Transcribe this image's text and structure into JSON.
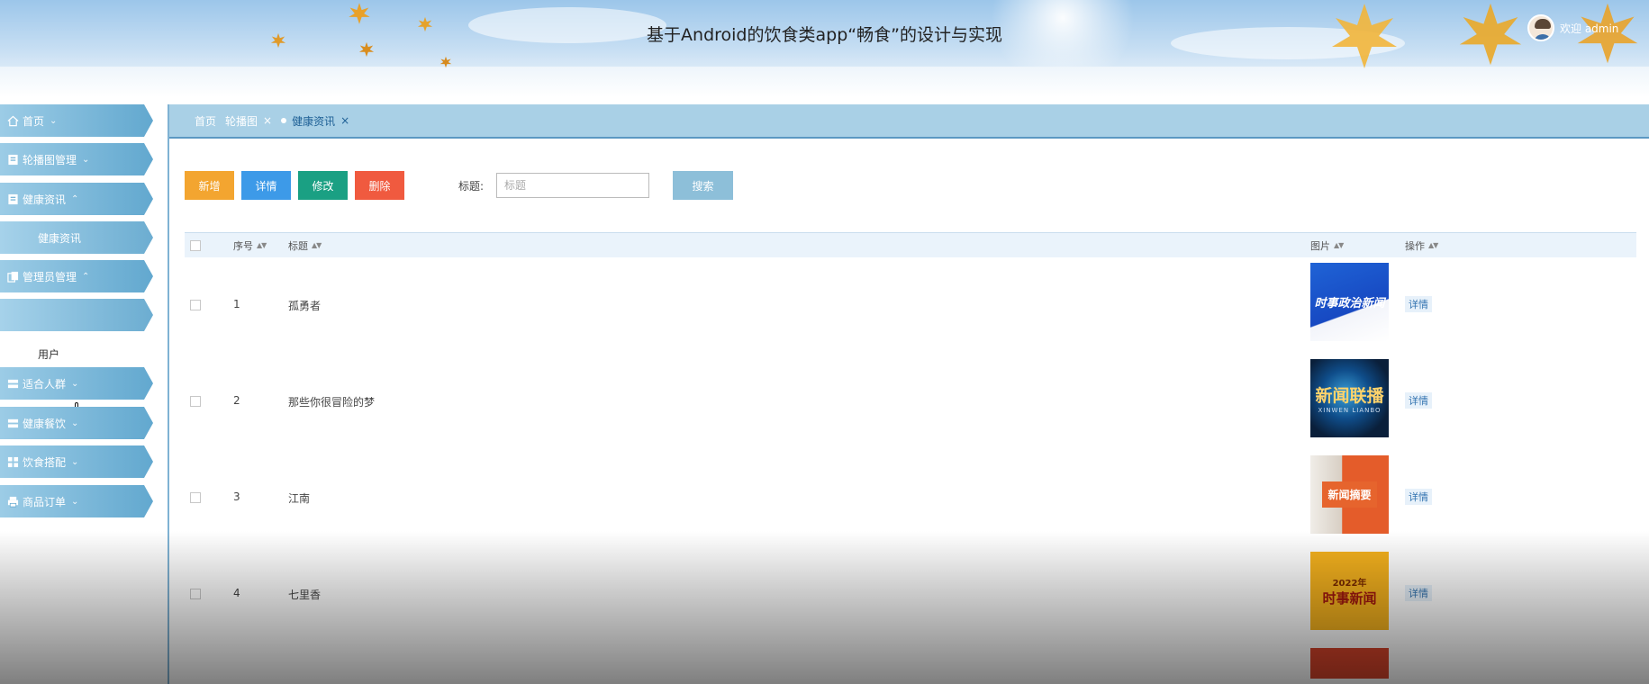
{
  "header": {
    "title": "基于Android的饮食类app“畅食”的设计与实现",
    "welcome": "欢迎 admin"
  },
  "sidebar": {
    "items": [
      {
        "label": "首页",
        "icon": "home-icon",
        "expanded": false
      },
      {
        "label": "轮播图管理",
        "icon": "doc-icon",
        "expanded": false
      },
      {
        "label": "健康资讯",
        "icon": "doc-icon",
        "expanded": true
      },
      {
        "label": "健康资讯",
        "sub": true
      },
      {
        "label": "管理员管理",
        "icon": "copy-icon",
        "expanded": true
      },
      {
        "label": "",
        "sub": true
      },
      {
        "label": "用户",
        "plain": true
      },
      {
        "label": "适合人群",
        "icon": "table-icon",
        "expanded": false
      },
      {
        "label": "健康餐饮",
        "icon": "table-icon",
        "expanded": false
      },
      {
        "label": "饮食搭配",
        "icon": "grid-icon",
        "expanded": false
      },
      {
        "label": "商品订单",
        "icon": "print-icon",
        "expanded": false
      }
    ]
  },
  "tabs": [
    {
      "label": "首页",
      "closable": false,
      "active": false
    },
    {
      "label": "轮播图",
      "closable": true,
      "active": false
    },
    {
      "label": "健康资讯",
      "closable": true,
      "active": true
    }
  ],
  "close_glyph": "×",
  "toolbar": {
    "add": "新增",
    "detail": "详情",
    "edit": "修改",
    "delete": "删除",
    "search_label": "标题:",
    "search_placeholder": "标题",
    "search_button": "搜索"
  },
  "table": {
    "headers": {
      "no": "序号",
      "title": "标题",
      "image": "图片",
      "action": "操作"
    },
    "rows": [
      {
        "no": "1",
        "title": "孤勇者",
        "image_text": "时事政治新闻",
        "action": "详情"
      },
      {
        "no": "2",
        "title": "那些你很冒险的梦",
        "image_text": "新闻联播",
        "image_sub": "XINWEN LIANBO",
        "action": "详情"
      },
      {
        "no": "3",
        "title": "江南",
        "image_text": "新闻摘要",
        "action": "详情"
      },
      {
        "no": "4",
        "title": "七里香",
        "image_text": "时事新闻",
        "image_sub": "2022年",
        "action": "详情"
      }
    ]
  },
  "colors": {
    "add": "#f3a530",
    "detail": "#3d9ae8",
    "edit": "#1aa083",
    "delete": "#f05a3f",
    "search": "#8dbfd9",
    "sidebar": "#62a8cf"
  }
}
